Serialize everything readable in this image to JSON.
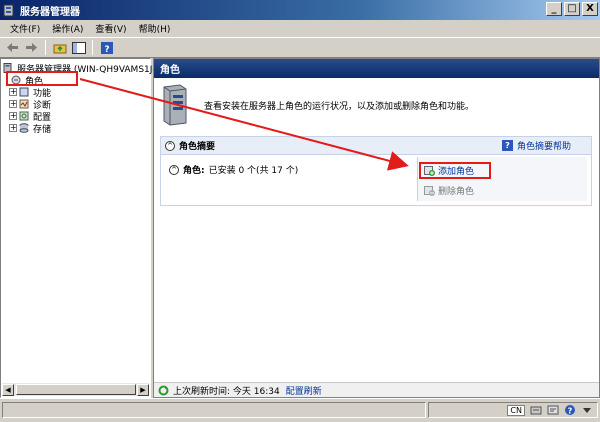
{
  "window": {
    "title": "服务器管理器",
    "min": "_",
    "max": "□",
    "close": "X"
  },
  "menu": [
    "文件(F)",
    "操作(A)",
    "查看(V)",
    "帮助(H)"
  ],
  "tree": {
    "root": "服务器管理器 (WIN-QH9VAMS1J4",
    "items": [
      {
        "label": "角色",
        "selected": true
      },
      {
        "label": "功能"
      },
      {
        "label": "诊断"
      },
      {
        "label": "配置"
      },
      {
        "label": "存储"
      }
    ]
  },
  "main": {
    "header": "角色",
    "description": "查看安装在服务器上角色的运行状况，以及添加或删除角色和功能。",
    "summary": {
      "title": "角色摘要",
      "help": "角色摘要帮助",
      "roles_line": "角色: 已安装 0 个(共 17 个)",
      "roles_label": "角色:",
      "roles_value": "已安装 0 个(共 17 个)",
      "add_role": "添加角色",
      "remove_role": "删除角色"
    },
    "status": {
      "last_refresh": "上次刷新时间: 今天 16:34",
      "configure_refresh": "配置刷新"
    }
  },
  "tray": {
    "ime": "CN"
  },
  "colors": {
    "title_gradient_start": "#0a246a",
    "highlight_red": "#e21b1b",
    "link_blue": "#003399"
  }
}
